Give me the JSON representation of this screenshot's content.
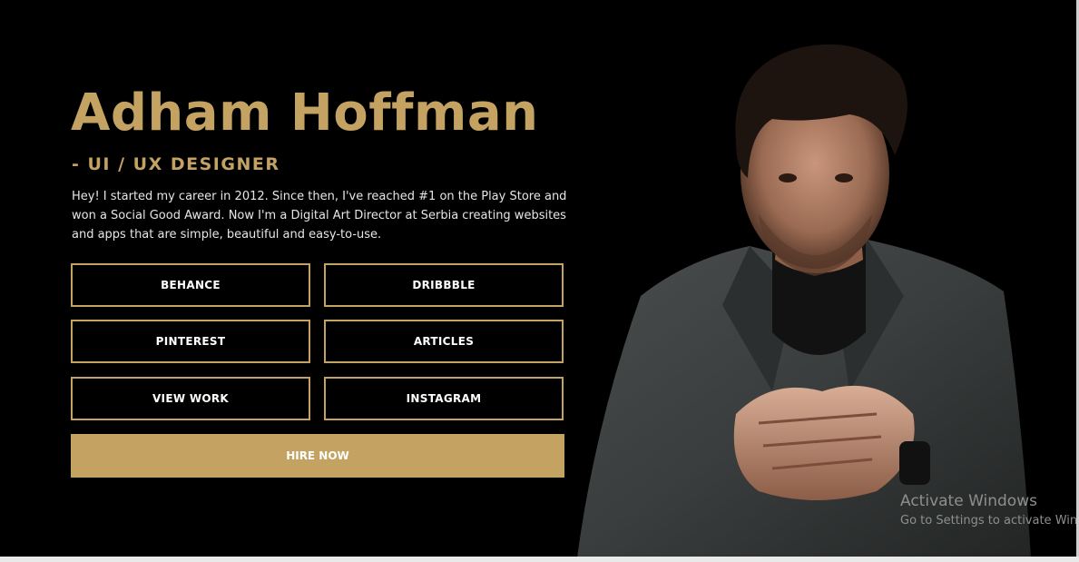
{
  "hero": {
    "name": "Adham Hoffman",
    "role": "- UI / UX DESIGNER",
    "bio": "Hey! I started my career in 2012. Since then, I've reached #1 on the Play Store and won a Social Good Award. Now I'm a Digital Art Director at Serbia creating websites and apps that are simple, beautiful and easy-to-use."
  },
  "buttons": {
    "behance": "BEHANCE",
    "dribbble": "DRIBBBLE",
    "pinterest": "PINTEREST",
    "articles": "ARTICLES",
    "view_work": "VIEW WORK",
    "instagram": "INSTAGRAM",
    "hire_now": "HIRE NOW"
  },
  "watermark": {
    "title": "Activate Windows",
    "subtitle": "Go to Settings to activate Windows."
  },
  "colors": {
    "accent": "#c3a262",
    "background": "#000000",
    "text": "#e6e6e6"
  }
}
